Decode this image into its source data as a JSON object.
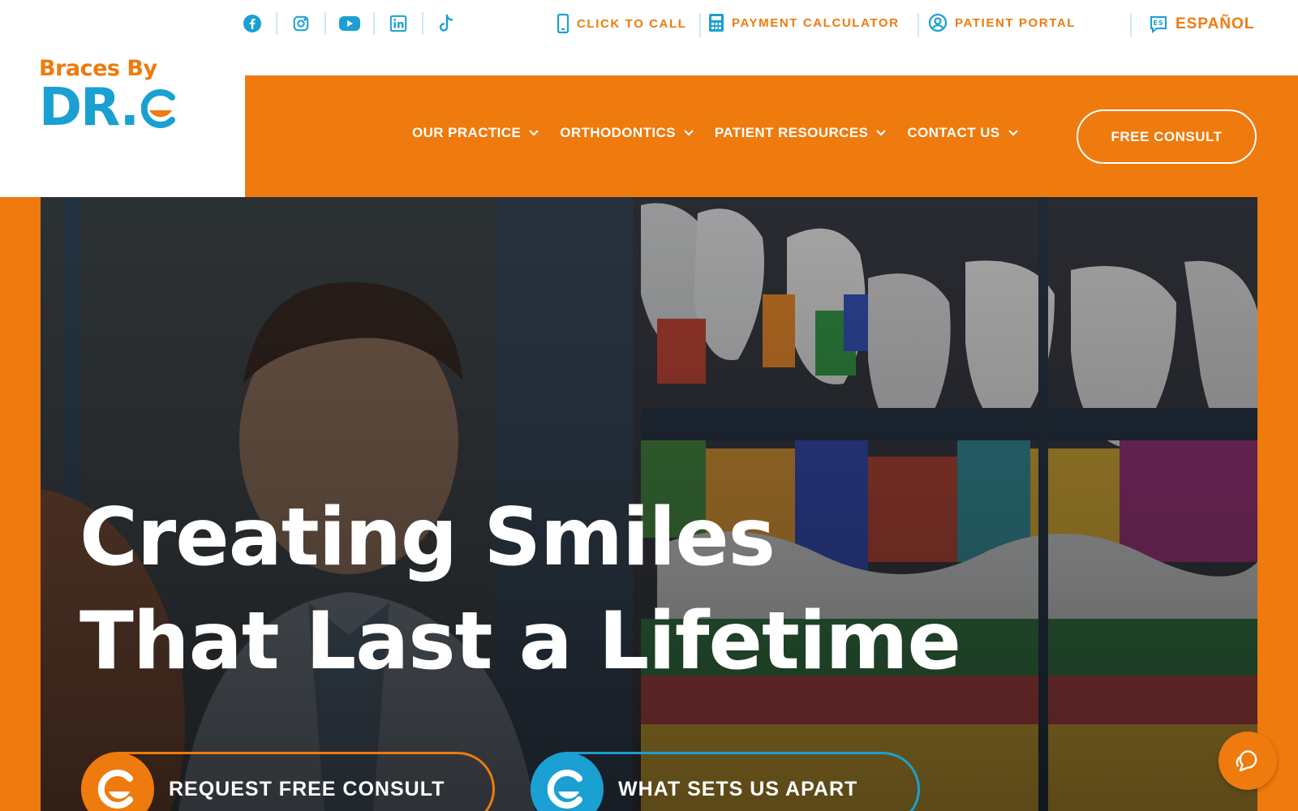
{
  "brand": {
    "line1": "Braces By",
    "line2": "DR.",
    "colors": {
      "orange": "#ef7a0e",
      "blue": "#1aa0d2"
    }
  },
  "social": [
    "facebook-icon",
    "instagram-icon",
    "youtube-icon",
    "linkedin-icon",
    "tiktok-icon"
  ],
  "utility": {
    "call": "CLICK TO CALL",
    "payment": "PAYMENT CALCULATOR",
    "portal": "PATIENT PORTAL",
    "language": "ESPAÑOL",
    "language_badge": "ES"
  },
  "nav": {
    "items": [
      {
        "label": "OUR PRACTICE"
      },
      {
        "label": "ORTHODONTICS"
      },
      {
        "label": "PATIENT RESOURCES"
      },
      {
        "label": "CONTACT US"
      }
    ],
    "cta": "FREE CONSULT"
  },
  "hero": {
    "headline_line1": "Creating Smiles",
    "headline_line2": "That Last a Lifetime",
    "buttons": {
      "consult": "REQUEST FREE CONSULT",
      "apart": "WHAT SETS US APART"
    }
  },
  "chat": {
    "icon": "chat-icon"
  }
}
